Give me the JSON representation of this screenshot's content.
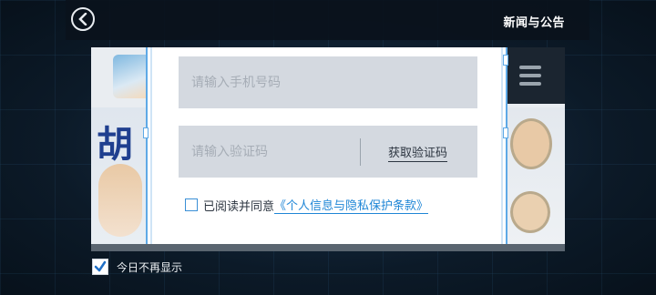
{
  "header": {
    "back_icon": "chevron-left-icon",
    "title": "新闻与公告"
  },
  "login_form": {
    "phone_placeholder": "请输入手机号码",
    "code_placeholder": "请输入验证码",
    "get_code_label": "获取验证码",
    "agreement_prefix": "已阅读并同意",
    "agreement_link": "《个人信息与隐私保护条款》",
    "agreement_checked": false
  },
  "footer": {
    "no_show_today_label": "今日不再显示",
    "no_show_today_checked": true
  },
  "background_art": {
    "glyph": "胡"
  },
  "colors": {
    "accent": "#1f86d6",
    "frame_border": "#5ea9e6",
    "input_bg": "#d4d9e0",
    "page_bg": "#0b1622"
  }
}
